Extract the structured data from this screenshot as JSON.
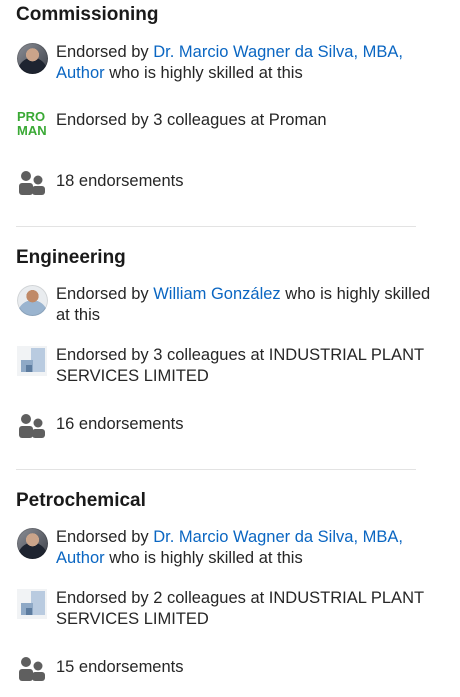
{
  "skills": [
    {
      "title": "Commissioning",
      "endorser": {
        "prefix": "Endorsed by ",
        "name": "Dr. Marcio Wagner da Silva, MBA, Author",
        "suffix": " who is highly skilled at this"
      },
      "colleagues": "Endorsed by 3 colleagues at Proman",
      "count": "18 endorsements"
    },
    {
      "title": "Engineering",
      "endorser": {
        "prefix": "Endorsed by ",
        "name": "William González",
        "suffix": " who is highly skilled at this"
      },
      "colleagues": "Endorsed by 3 colleagues at INDUSTRIAL PLANT SERVICES LIMITED",
      "count": "16 endorsements"
    },
    {
      "title": "Petrochemical",
      "endorser": {
        "prefix": "Endorsed by ",
        "name": "Dr. Marcio Wagner da Silva, MBA, Author",
        "suffix": " who is highly skilled at this"
      },
      "colleagues": "Endorsed by 2 colleagues at INDUSTRIAL PLANT SERVICES LIMITED",
      "count": "15 endorsements"
    }
  ],
  "logos": {
    "proman_line1": "PRO",
    "proman_line2": "MAN"
  },
  "icons": {
    "people": "people-icon",
    "company_proman": "proman-logo",
    "company_plant": "company-logo-icon"
  },
  "colors": {
    "link": "#0a66c2",
    "proman_green": "#3aa935",
    "divider": "#e3e3e3"
  }
}
